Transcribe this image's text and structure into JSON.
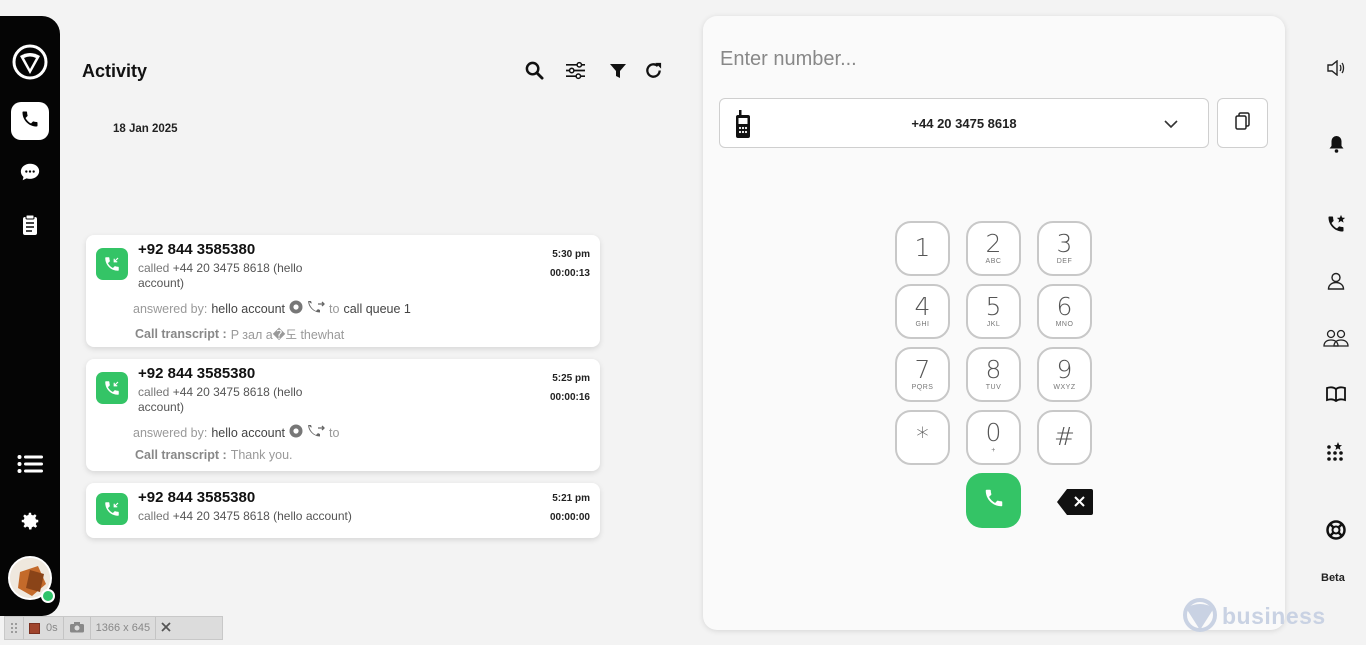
{
  "left_nav": {
    "items": [
      "app-logo",
      "phone",
      "chat",
      "notes",
      "list",
      "settings"
    ]
  },
  "activity": {
    "title": "Activity",
    "date": "18 Jan 2025",
    "calls": [
      {
        "number": "+92 844 3585380",
        "called_prefix": "called",
        "called_line1": "+44 20 3475 8618 (hello",
        "called_line2": "account)",
        "time": "5:30 pm",
        "duration": "00:00:13",
        "answered_label": "answered by:",
        "answered_by": "hello account",
        "to_label": "to",
        "to_target": "call queue 1",
        "transcript_label": "Call transcript :",
        "transcript": "P зал a�도 thewhat"
      },
      {
        "number": "+92 844 3585380",
        "called_prefix": "called",
        "called_line1": "+44 20 3475 8618 (hello",
        "called_line2": "account)",
        "time": "5:25 pm",
        "duration": "00:00:16",
        "answered_label": "answered by:",
        "answered_by": "hello account",
        "to_label": "to",
        "transcript_label": "Call transcript :",
        "transcript": "Thank you."
      },
      {
        "number": "+92 844 3585380",
        "called_prefix": "called",
        "called_line1": "+44 20 3475 8618 (hello account)",
        "time": "5:21 pm",
        "duration": "00:00:00"
      }
    ]
  },
  "dialer": {
    "placeholder": "Enter number...",
    "selected_number": "+44 20 3475 8618",
    "keys": [
      {
        "digit": "1",
        "letters": ""
      },
      {
        "digit": "2",
        "letters": "ABC"
      },
      {
        "digit": "3",
        "letters": "DEF"
      },
      {
        "digit": "4",
        "letters": "GHI"
      },
      {
        "digit": "5",
        "letters": "JKL"
      },
      {
        "digit": "6",
        "letters": "MNO"
      },
      {
        "digit": "7",
        "letters": "PQRS"
      },
      {
        "digit": "8",
        "letters": "TUV"
      },
      {
        "digit": "9",
        "letters": "WXYZ"
      },
      {
        "digit": "*",
        "letters": ""
      },
      {
        "digit": "0",
        "letters": "+"
      },
      {
        "digit": "#",
        "letters": ""
      }
    ]
  },
  "right_rail": {
    "beta_label": "Beta"
  },
  "watermark": "business",
  "recorder": {
    "elapsed": "0s",
    "size": "1366 x 645"
  },
  "colors": {
    "accent_green": "#34c466",
    "sidebar": "#050505"
  }
}
